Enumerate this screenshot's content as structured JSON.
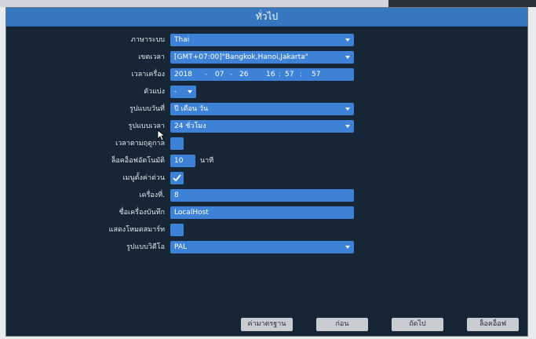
{
  "window": {
    "title": "ทั่วไป"
  },
  "fields": {
    "language": {
      "label": "ภาษาระบบ",
      "value": "Thai"
    },
    "timezone": {
      "label": "เขตเวลา",
      "value": "[GMT+07:00]\"Bangkok,Hanoi,Jakarta\""
    },
    "system_time": {
      "label": "เวลาเครื่อง",
      "year": "2018",
      "month": "07",
      "day": "26",
      "hour": "16",
      "minute": "57",
      "second": "57"
    },
    "date_separator": {
      "label": "ตัวแบ่ง",
      "value": "-"
    },
    "date_format": {
      "label": "รูปแบบวันที่",
      "value": "ปี เดือน วัน"
    },
    "time_format": {
      "label": "รูปแบบเวลา",
      "value": "24 ชั่วโมง"
    },
    "dst": {
      "label": "เวลาตามฤดูกาล",
      "checked": false
    },
    "auto_logout": {
      "label": "ล็อคอ็อฟอัตโนมัติ",
      "value": "10",
      "unit": "นาที"
    },
    "startup_wizard": {
      "label": "เมนูตั้งค่าด่วน",
      "checked": true
    },
    "device_no": {
      "label": "เครื่องที่.",
      "value": "8"
    },
    "device_name": {
      "label": "ชื่อเครื่องบันทึก",
      "value": "LocalHost"
    },
    "show_mouse": {
      "label": "แสดงโหมดสมาร์ท",
      "checked": false
    },
    "video_standard": {
      "label": "รูปแบบวิดีโอ",
      "value": "PAL"
    }
  },
  "buttons": {
    "default": "ค่ามาตรฐาน",
    "prev": "ก่อน",
    "next": "ถัดไป",
    "logout": "ล็อคอ็อฟ"
  },
  "colors": {
    "panel": "#162637",
    "title_bar": "#3777bf",
    "control": "#3d82d6",
    "button": "#c9cdd2"
  }
}
